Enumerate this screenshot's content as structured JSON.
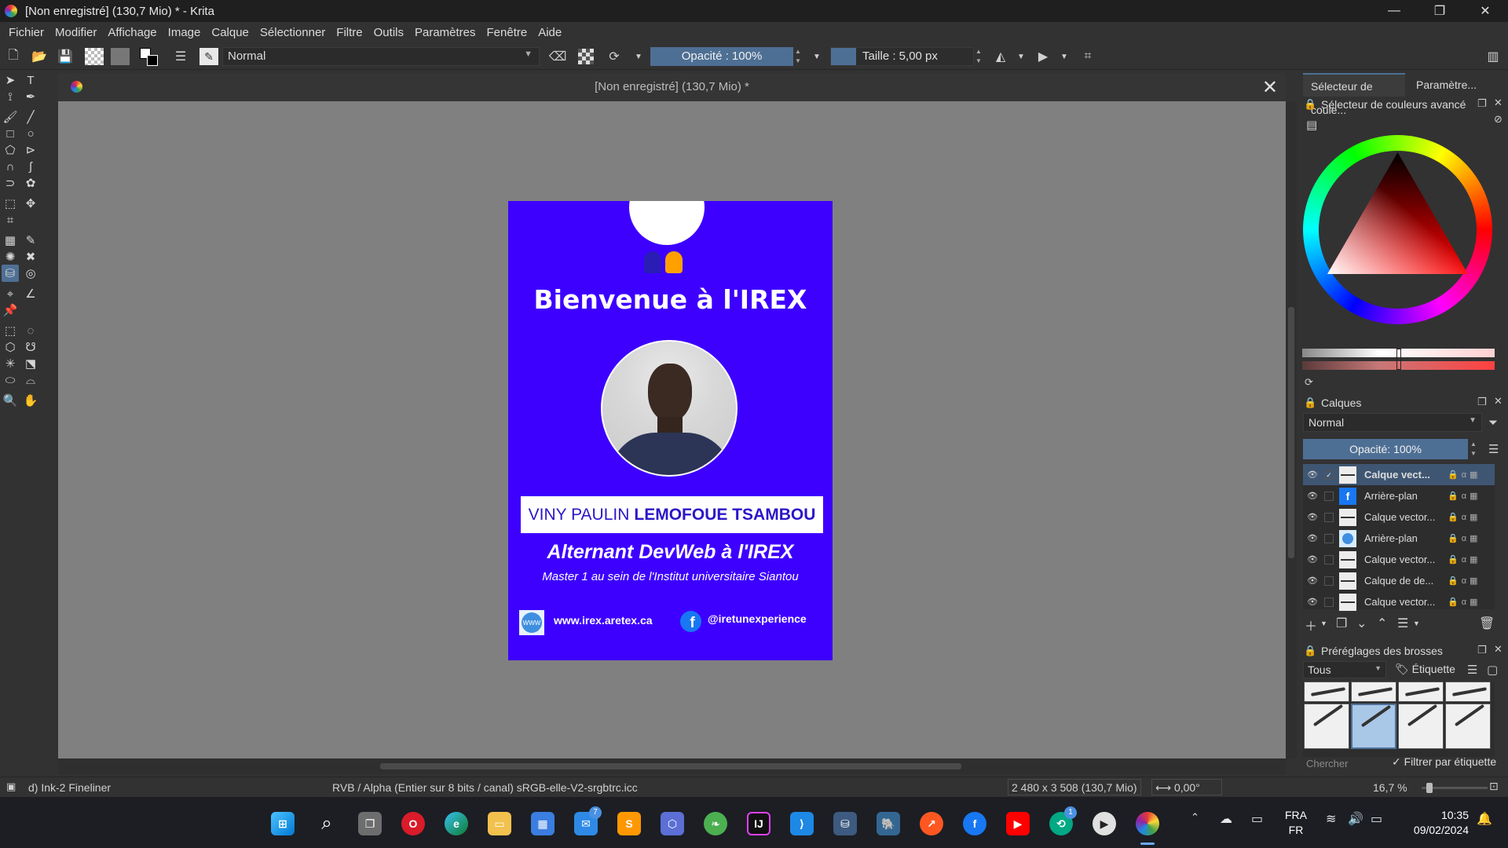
{
  "window": {
    "title": "[Non enregistré]  (130,7 Mio) * - Krita",
    "minimize": "—",
    "maximize": "❐",
    "close": "✕"
  },
  "menu": [
    "Fichier",
    "Modifier",
    "Affichage",
    "Image",
    "Calque",
    "Sélectionner",
    "Filtre",
    "Outils",
    "Paramètres",
    "Fenêtre",
    "Aide"
  ],
  "toolbar": {
    "blend_mode": "Normal",
    "opacity": "Opacité : 100%",
    "size": "Taille :  5,00 px"
  },
  "document": {
    "tab_title": "[Non enregistré]  (130,7 Mio) *",
    "close": "✕"
  },
  "poster": {
    "background_color": "#3d00ff",
    "title": "Bienvenue à l'IREX",
    "name_first": "VINY PAULIN",
    "name_last": "LEMOFOUE TSAMBOU",
    "job": "Alternant DevWeb à l'IREX",
    "school": "Master 1 au sein de l'Institut universitaire Siantou",
    "website": "www.irex.aretex.ca",
    "facebook": "@iretunexperience",
    "www_label": "WWW",
    "fb_letter": "f"
  },
  "dockers": {
    "tabs": [
      "Sélecteur de coule...",
      "Paramètre..."
    ],
    "color_selector_title": "Sélecteur de couleurs avancé",
    "layers_title": "Calques",
    "layers_blend": "Normal",
    "layers_opacity": "Opacité:  100%",
    "layers": [
      {
        "name": "Calque vect...",
        "thumb": "line",
        "selected": true
      },
      {
        "name": "Arrière-plan",
        "thumb": "fb",
        "selected": false
      },
      {
        "name": "Calque vector...",
        "thumb": "line",
        "selected": false
      },
      {
        "name": "Arrière-plan",
        "thumb": "globe",
        "selected": false
      },
      {
        "name": "Calque vector...",
        "thumb": "line",
        "selected": false
      },
      {
        "name": "Calque de de...",
        "thumb": "line",
        "selected": false
      },
      {
        "name": "Calque vector...",
        "thumb": "line",
        "selected": false
      }
    ],
    "brush_presets_title": "Préréglages des brosses",
    "brush_filter": "Tous",
    "brush_tag": "Étiquette",
    "brush_search_placeholder": "Chercher",
    "brush_filter_by_tag": "Filtrer par étiquette"
  },
  "status": {
    "brush": "d) Ink-2 Fineliner",
    "color_profile": "RVB / Alpha (Entier sur 8 bits / canal)  sRGB-elle-V2-srgbtrc.icc",
    "dimensions": "2 480 x 3 508 (130,7 Mio)",
    "rotation": "0,00°",
    "zoom": "16,7 %"
  },
  "taskbar": {
    "lang_top": "FRA",
    "lang_bottom": "FR",
    "time": "10:35",
    "date": "09/02/2024",
    "mail_badge": "7",
    "app_badge": "1"
  },
  "colors": {
    "accent": "#4e6f94",
    "panel_bg": "#323232",
    "canvas_bg": "#808080"
  }
}
